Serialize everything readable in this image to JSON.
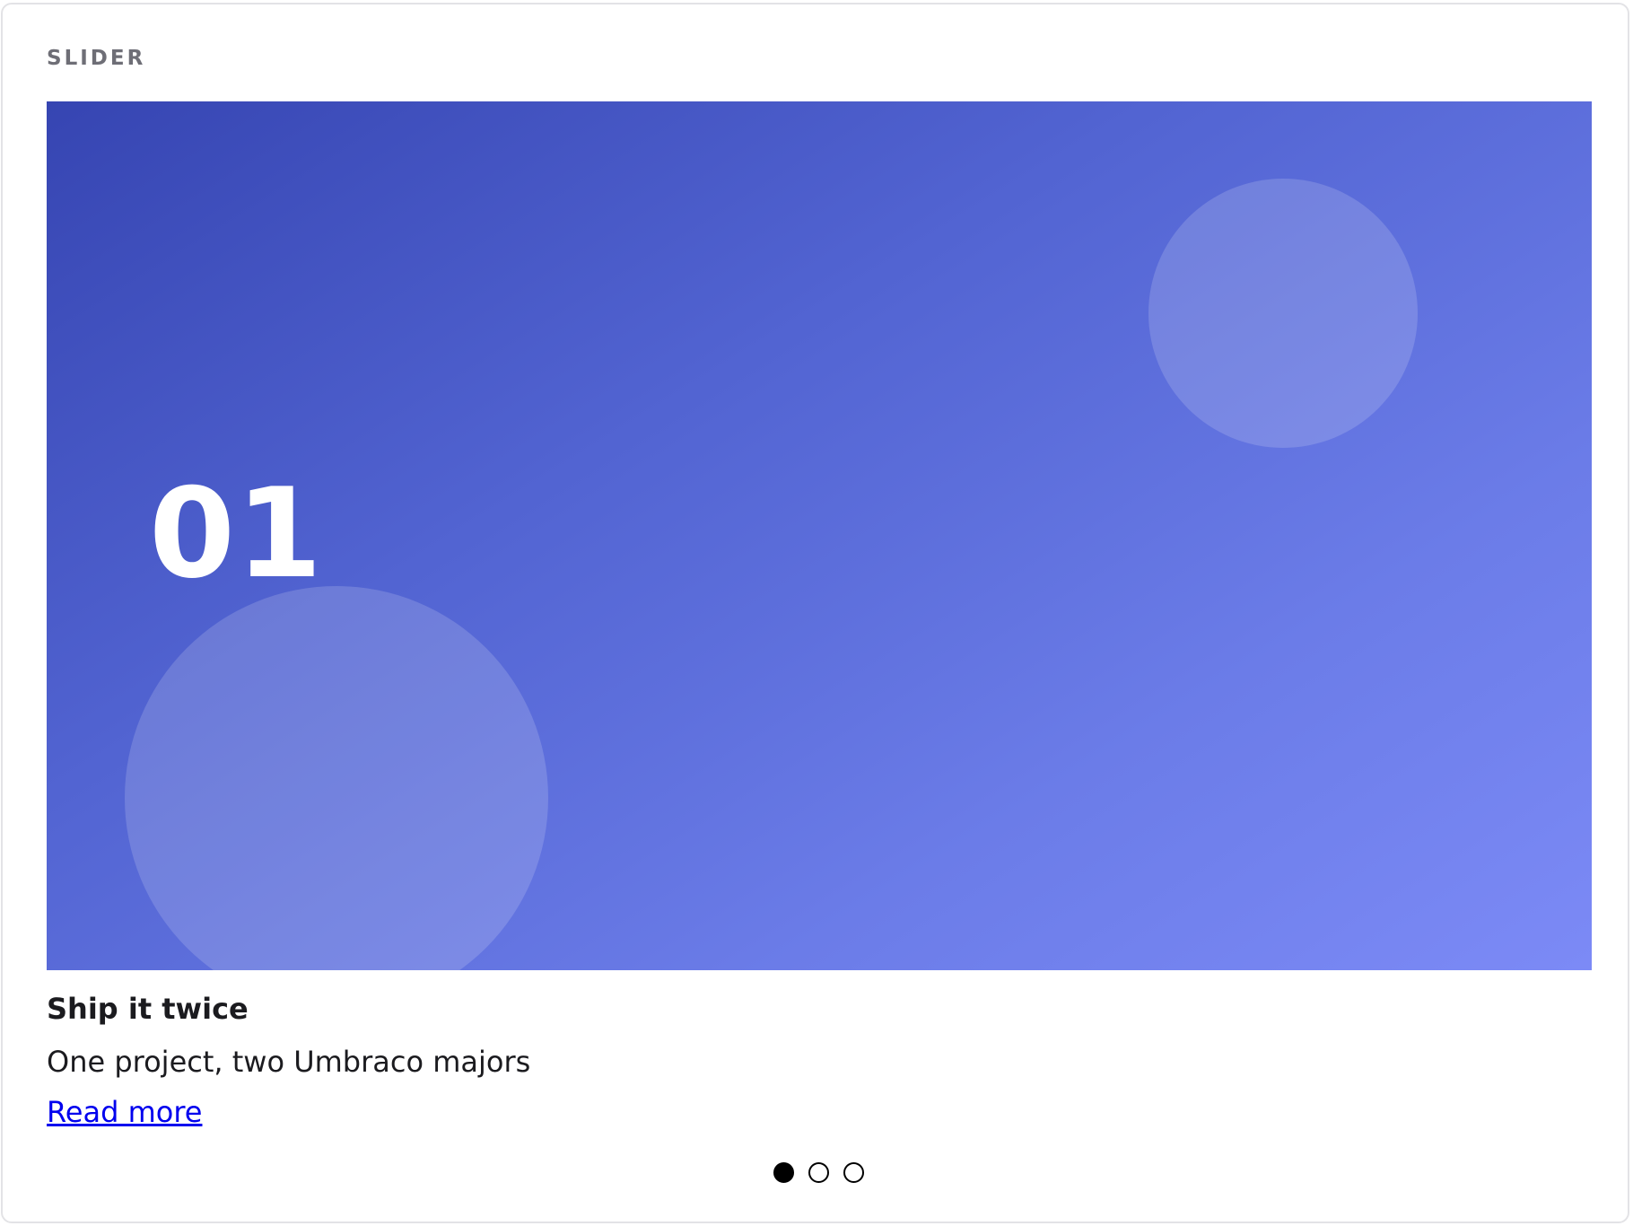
{
  "section": {
    "label": "SLIDER"
  },
  "slider": {
    "active_index": 0,
    "slide": {
      "number": "01",
      "title": "Ship it twice",
      "subtitle": "One project, two Umbraco majors",
      "link_label": "Read more",
      "gradient_colors": [
        "#3645b2",
        "#5264d2",
        "#7c8af6"
      ]
    },
    "dots": [
      {
        "active": true
      },
      {
        "active": false
      },
      {
        "active": false
      }
    ]
  }
}
